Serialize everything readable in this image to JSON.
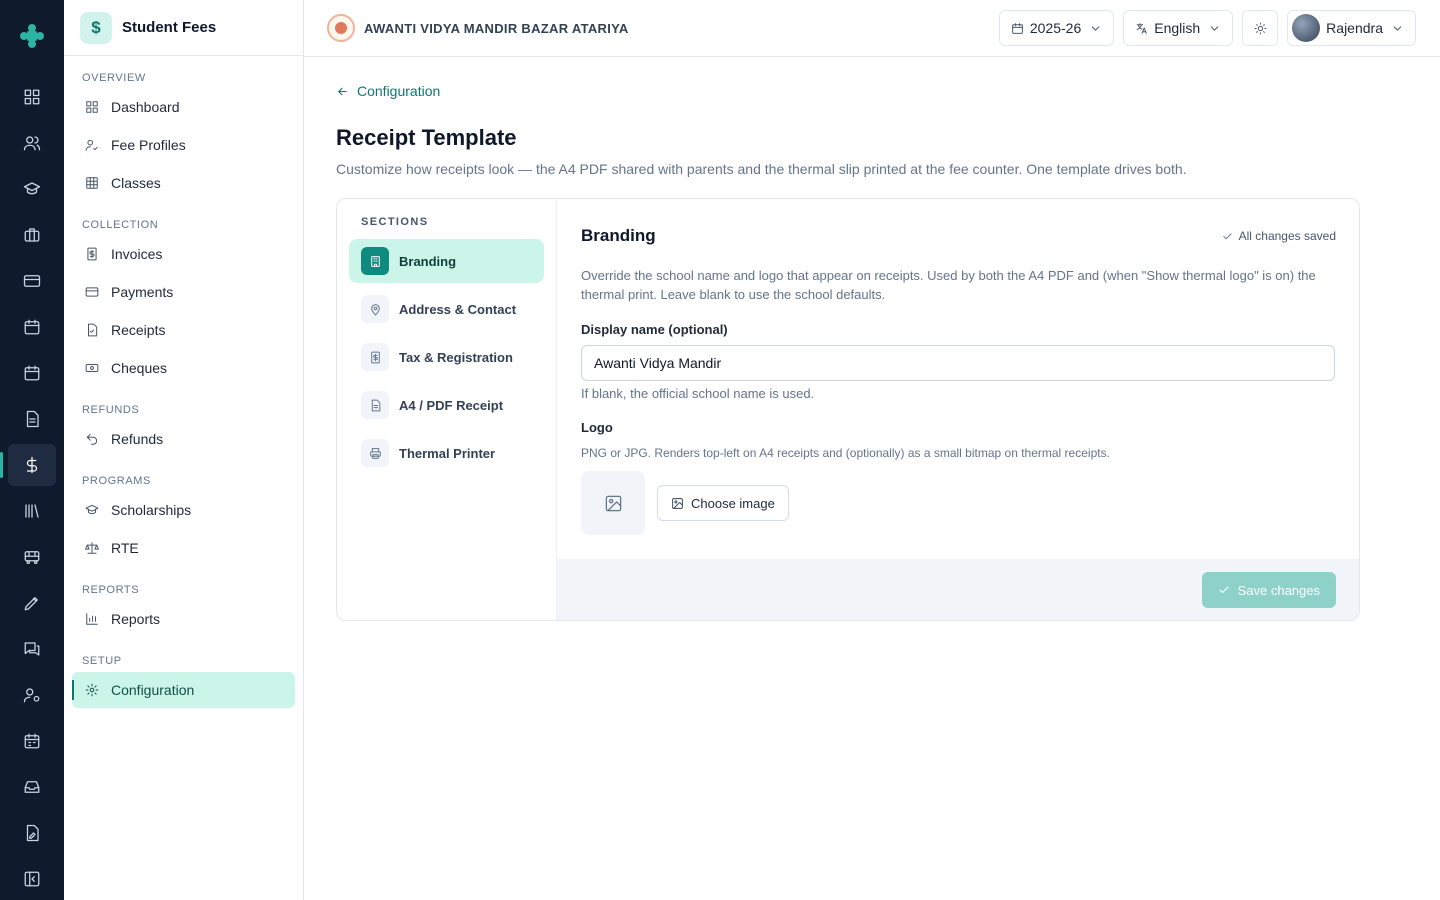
{
  "app": {
    "title": "Student Fees",
    "badge_symbol": "$"
  },
  "sidebar": {
    "groups": [
      {
        "label": "OVERVIEW",
        "items": [
          {
            "label": "Dashboard",
            "icon": "dashboard-icon"
          },
          {
            "label": "Fee Profiles",
            "icon": "user-check-icon"
          },
          {
            "label": "Classes",
            "icon": "grid-icon"
          }
        ]
      },
      {
        "label": "COLLECTION",
        "items": [
          {
            "label": "Invoices",
            "icon": "invoice-icon"
          },
          {
            "label": "Payments",
            "icon": "card-icon"
          },
          {
            "label": "Receipts",
            "icon": "receipt-icon"
          },
          {
            "label": "Cheques",
            "icon": "cheque-icon"
          }
        ]
      },
      {
        "label": "REFUNDS",
        "items": [
          {
            "label": "Refunds",
            "icon": "undo-icon"
          }
        ]
      },
      {
        "label": "PROGRAMS",
        "items": [
          {
            "label": "Scholarships",
            "icon": "graduation-cap-icon"
          },
          {
            "label": "RTE",
            "icon": "scales-icon"
          }
        ]
      },
      {
        "label": "REPORTS",
        "items": [
          {
            "label": "Reports",
            "icon": "bar-chart-icon"
          }
        ]
      },
      {
        "label": "SETUP",
        "items": [
          {
            "label": "Configuration",
            "icon": "gear-icon",
            "active": true
          }
        ]
      }
    ]
  },
  "topbar": {
    "school_name": "AWANTI VIDYA MANDIR BAZAR ATARIYA",
    "session": "2025-26",
    "language": "English",
    "user": "Rajendra"
  },
  "page": {
    "back_label": "Configuration",
    "title": "Receipt Template",
    "description": "Customize how receipts look — the A4 PDF shared with parents and the thermal slip printed at the fee counter. One template drives both."
  },
  "sections": {
    "label": "SECTIONS",
    "items": [
      {
        "label": "Branding",
        "icon": "building-icon",
        "active": true
      },
      {
        "label": "Address & Contact",
        "icon": "map-pin-icon"
      },
      {
        "label": "Tax & Registration",
        "icon": "tax-receipt-icon"
      },
      {
        "label": "A4 / PDF Receipt",
        "icon": "document-icon"
      },
      {
        "label": "Thermal Printer",
        "icon": "printer-icon"
      }
    ]
  },
  "branding": {
    "title": "Branding",
    "saved_status": "All changes saved",
    "description": "Override the school name and logo that appear on receipts. Used by both the A4 PDF and (when \"Show thermal logo\" is on) the thermal print. Leave blank to use the school defaults.",
    "display_name_label": "Display name (optional)",
    "display_name_value": "Awanti Vidya Mandir",
    "display_name_hint": "If blank, the official school name is used.",
    "logo_label": "Logo",
    "logo_hint": "PNG or JPG. Renders top-left on A4 receipts and (optionally) as a small bitmap on thermal receipts.",
    "choose_image_label": "Choose image",
    "save_label": "Save changes"
  },
  "colors": {
    "rail_bg": "#0f1b2d",
    "accent": "#0f766e",
    "active_bg": "#ccf5ea",
    "save_button_disabled": "#8dd1c9"
  }
}
